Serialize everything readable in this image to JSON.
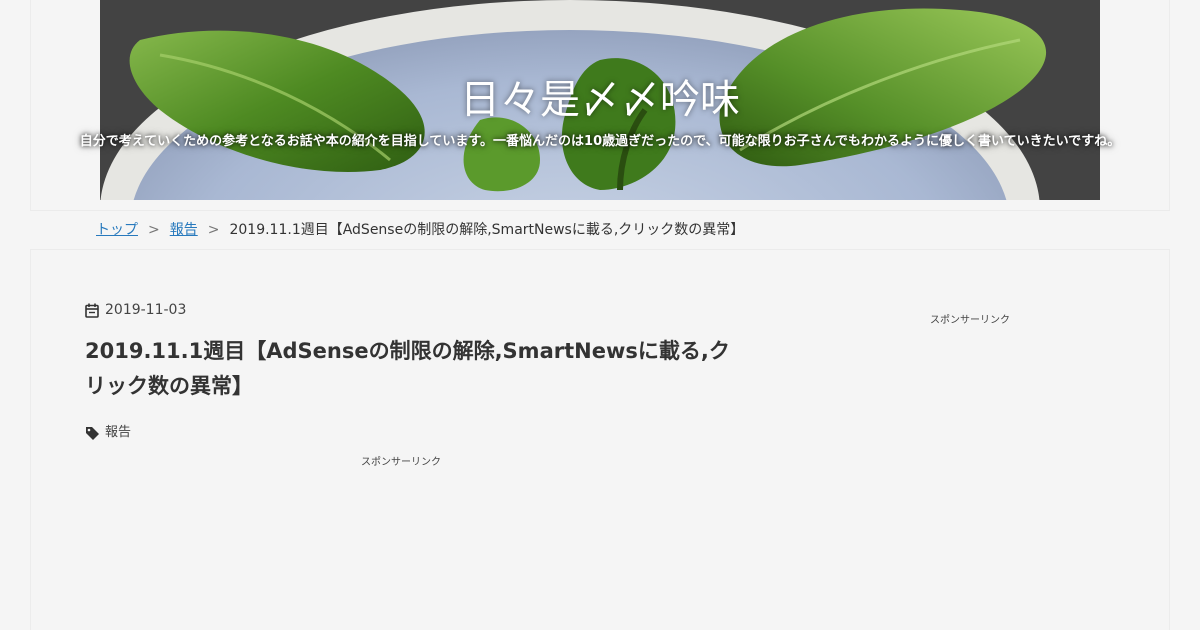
{
  "header": {
    "site_title": "日々是〆〆吟味",
    "site_description": "自分で考えていくための参考となるお話や本の紹介を目指しています。一番悩んだのは10歳過ぎだったので、可能な限りお子さんでもわかるように優しく書いていきたいですね。"
  },
  "breadcrumb": {
    "items": [
      {
        "label": "トップ",
        "link": true
      },
      {
        "label": "報告",
        "link": true
      },
      {
        "label": "2019.11.1週目【AdSenseの制限の解除,SmartNewsに載る,クリック数の異常】",
        "link": false
      }
    ],
    "separator": ">"
  },
  "post": {
    "date": "2019-11-03",
    "date_icon": "calendar-icon",
    "title": "2019.11.1週目【AdSenseの制限の解除,SmartNewsに載る,クリック数の異常】",
    "tag_icon": "tag-icon",
    "tags": [
      "報告"
    ]
  },
  "ads": {
    "main_label": "スポンサーリンク",
    "side_label": "スポンサーリンク"
  },
  "colors": {
    "background": "#f5f5f5",
    "link": "#2779bd",
    "text": "#333333"
  }
}
